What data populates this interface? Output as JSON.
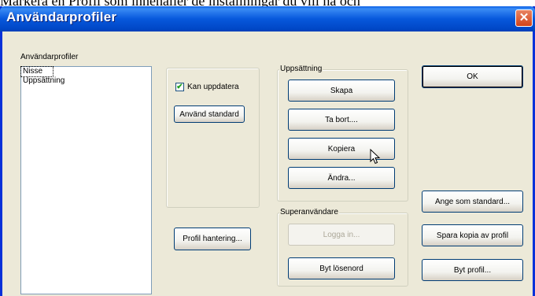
{
  "caption": "Markera en Profil som innehåller de inställningar du vill ha och",
  "window": {
    "title": "Användarprofiler",
    "close_glyph": "✕"
  },
  "profiles": {
    "label": "Användarprofiler",
    "items": [
      {
        "label": "Nisse",
        "selected": true
      },
      {
        "label": "Uppsättning",
        "selected": false
      }
    ]
  },
  "middle": {
    "checkbox_label": "Kan uppdatera",
    "checkbox_checked": true,
    "check_glyph": "✔",
    "use_default_button": "Använd standard",
    "profile_handling_button": "Profil hantering..."
  },
  "setup": {
    "legend": "Uppsättning",
    "create_button": "Skapa",
    "delete_button": "Ta bort....",
    "copy_button": "Kopiera",
    "change_button": "Ändra..."
  },
  "superuser": {
    "legend": "Superanvändare",
    "login_button": "Logga in...",
    "change_password_button": "Byt lösenord"
  },
  "right": {
    "ok_button": "OK",
    "set_default_button": "Ange som standard...",
    "save_copy_button": "Spara kopia av profil",
    "change_profile_button": "Byt profil..."
  }
}
